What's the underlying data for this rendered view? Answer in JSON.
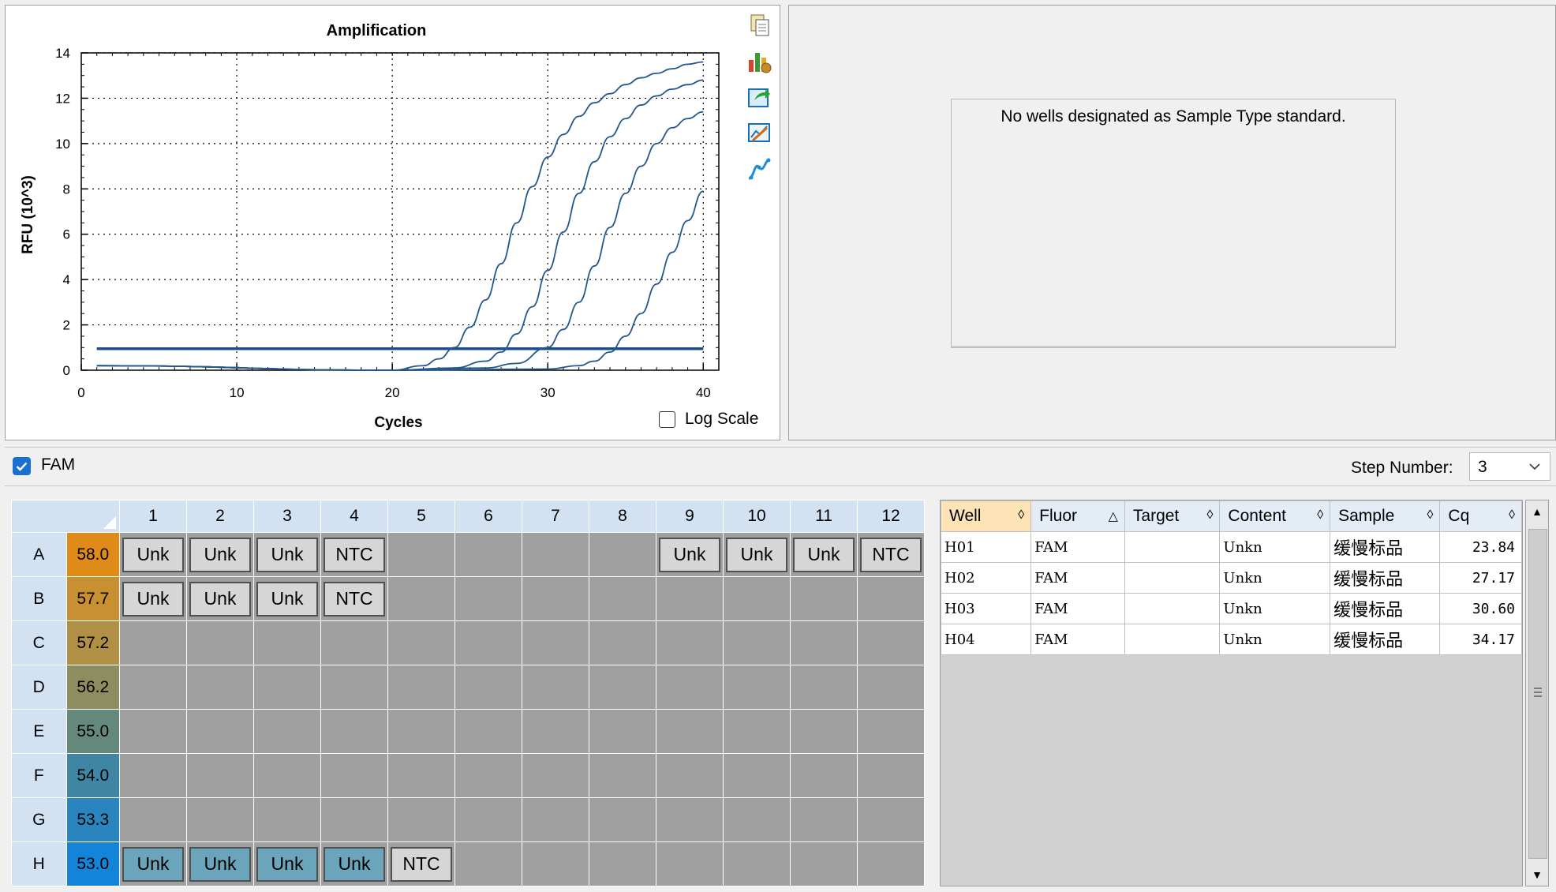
{
  "chart": {
    "title": "Amplification",
    "xlabel": "Cycles",
    "ylabel": "RFU (10^3)",
    "log_scale_label": "Log Scale",
    "log_scale_checked": false
  },
  "chart_data": {
    "type": "line",
    "title": "Amplification",
    "xlabel": "Cycles",
    "ylabel": "RFU (10^3)",
    "xlim": [
      0,
      41
    ],
    "ylim": [
      0,
      14
    ],
    "xticks": [
      0,
      10,
      20,
      30,
      40
    ],
    "yticks": [
      0,
      2,
      4,
      6,
      8,
      10,
      12,
      14
    ],
    "grid": true,
    "threshold": 0.95,
    "series": [
      {
        "x": [
          1,
          20,
          22,
          23,
          24,
          25,
          26,
          27,
          28,
          29,
          30,
          31,
          32,
          33,
          34,
          35,
          36,
          37,
          38,
          39,
          40
        ],
        "values": [
          0.2,
          0,
          0.2,
          0.5,
          1.0,
          1.9,
          3.1,
          4.7,
          6.5,
          8.1,
          9.4,
          10.4,
          11.2,
          11.8,
          12.2,
          12.6,
          12.9,
          13.1,
          13.3,
          13.5,
          13.6
        ]
      },
      {
        "x": [
          1,
          20,
          24,
          26,
          27,
          28,
          29,
          30,
          31,
          32,
          33,
          34,
          35,
          36,
          37,
          38,
          39,
          40
        ],
        "values": [
          0.2,
          0,
          0.1,
          0.4,
          0.8,
          1.6,
          2.8,
          4.4,
          6.1,
          7.8,
          9.2,
          10.3,
          11.1,
          11.7,
          12.1,
          12.4,
          12.6,
          12.8
        ]
      },
      {
        "x": [
          1,
          20,
          26,
          28,
          30,
          31,
          32,
          33,
          34,
          35,
          36,
          37,
          38,
          39,
          40
        ],
        "values": [
          0.2,
          0,
          0.1,
          0.3,
          1.0,
          1.8,
          3.0,
          4.6,
          6.3,
          7.8,
          9.0,
          10.0,
          10.7,
          11.1,
          11.4
        ]
      },
      {
        "x": [
          1,
          20,
          30,
          32,
          33,
          34,
          35,
          36,
          37,
          38,
          39,
          40
        ],
        "values": [
          0.2,
          0,
          0.05,
          0.2,
          0.4,
          0.8,
          1.5,
          2.5,
          3.8,
          5.2,
          6.6,
          7.9
        ]
      }
    ]
  },
  "standard_curve": {
    "message": "No wells designated as Sample Type standard."
  },
  "fluor_bar": {
    "fam_label": "FAM",
    "step_label": "Step Number:",
    "step_value": "3"
  },
  "plate": {
    "columns": [
      "1",
      "2",
      "3",
      "4",
      "5",
      "6",
      "7",
      "8",
      "9",
      "10",
      "11",
      "12"
    ],
    "rows": [
      {
        "label": "A",
        "temp": "58.0",
        "color": "#e08a17",
        "wells": [
          "Unk",
          "Unk",
          "Unk",
          "NTC",
          "",
          "",
          "",
          "",
          "Unk",
          "Unk",
          "Unk",
          "NTC"
        ]
      },
      {
        "label": "B",
        "temp": "57.7",
        "color": "#c89030",
        "wells": [
          "Unk",
          "Unk",
          "Unk",
          "NTC",
          "",
          "",
          "",
          "",
          "",
          "",
          "",
          ""
        ]
      },
      {
        "label": "C",
        "temp": "57.2",
        "color": "#b09045",
        "wells": [
          "",
          "",
          "",
          "",
          "",
          "",
          "",
          "",
          "",
          "",
          "",
          ""
        ]
      },
      {
        "label": "D",
        "temp": "56.2",
        "color": "#8e8d60",
        "wells": [
          "",
          "",
          "",
          "",
          "",
          "",
          "",
          "",
          "",
          "",
          "",
          ""
        ]
      },
      {
        "label": "E",
        "temp": "55.0",
        "color": "#64897b",
        "wells": [
          "",
          "",
          "",
          "",
          "",
          "",
          "",
          "",
          "",
          "",
          "",
          ""
        ]
      },
      {
        "label": "F",
        "temp": "54.0",
        "color": "#3f86a5",
        "wells": [
          "",
          "",
          "",
          "",
          "",
          "",
          "",
          "",
          "",
          "",
          "",
          ""
        ]
      },
      {
        "label": "G",
        "temp": "53.3",
        "color": "#2a84bd",
        "wells": [
          "",
          "",
          "",
          "",
          "",
          "",
          "",
          "",
          "",
          "",
          "",
          ""
        ]
      },
      {
        "label": "H",
        "temp": "53.0",
        "color": "#1384d8",
        "wells": [
          "Unk",
          "Unk",
          "Unk",
          "Unk",
          "NTC",
          "",
          "",
          "",
          "",
          "",
          "",
          ""
        ]
      }
    ]
  },
  "results": {
    "headers": [
      "Well",
      "Fluor",
      "Target",
      "Content",
      "Sample",
      "Cq"
    ],
    "rows": [
      {
        "well": "H01",
        "fluor": "FAM",
        "target": "",
        "content": "Unkn",
        "sample": "缓慢标品",
        "cq": "23.84"
      },
      {
        "well": "H02",
        "fluor": "FAM",
        "target": "",
        "content": "Unkn",
        "sample": "缓慢标品",
        "cq": "27.17"
      },
      {
        "well": "H03",
        "fluor": "FAM",
        "target": "",
        "content": "Unkn",
        "sample": "缓慢标品",
        "cq": "30.60"
      },
      {
        "well": "H04",
        "fluor": "FAM",
        "target": "",
        "content": "Unkn",
        "sample": "缓慢标品",
        "cq": "34.17"
      }
    ]
  },
  "toolbar_icons": [
    "copy-icon",
    "bar-chart-settings-icon",
    "export-icon",
    "chart-tools-icon",
    "curve-icon"
  ]
}
